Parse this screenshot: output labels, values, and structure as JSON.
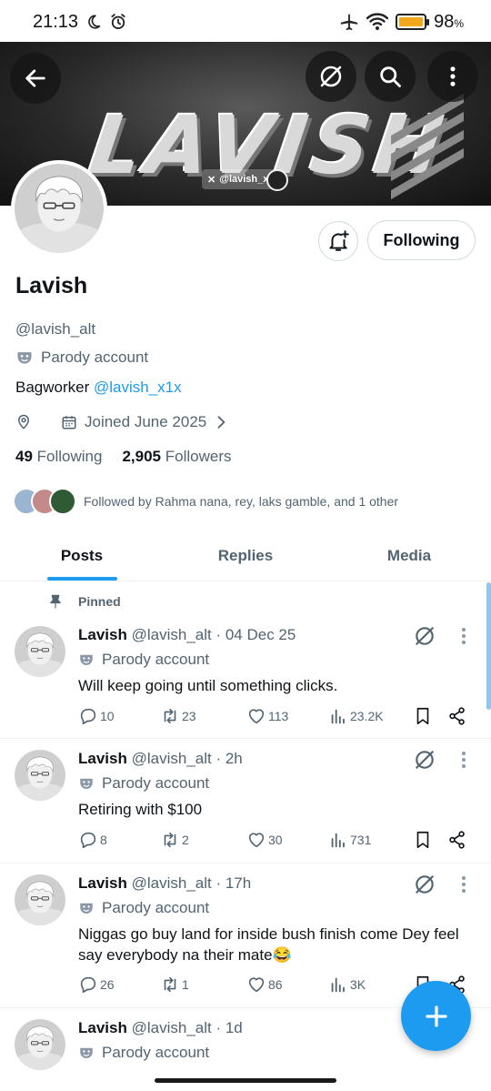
{
  "status_bar": {
    "time": "21:13",
    "battery": "98",
    "battery_unit": "%",
    "battery_level": 0.98
  },
  "banner": {
    "word": "LAVISH",
    "handle": "@lavish_x1x"
  },
  "profile": {
    "name": "Lavish",
    "handle": "@lavish_alt",
    "parody_label": "Parody account",
    "bio_text": "Bagworker ",
    "bio_mention": "@lavish_x1x",
    "joined": "Joined June 2025",
    "following_count": "49",
    "following_label": "Following",
    "followers_count": "2,905",
    "followers_label": "Followers",
    "followed_by": "Followed by Rahma nana, rey, laks gamble, and 1 other",
    "following_button": "Following"
  },
  "tabs": [
    {
      "label": "Posts"
    },
    {
      "label": "Replies"
    },
    {
      "label": "Media"
    }
  ],
  "pinned_label": "Pinned",
  "posts": [
    {
      "name": "Lavish",
      "meta": "@lavish_alt · 04 Dec 25",
      "parody": "Parody account",
      "text": "Will keep going until something clicks.",
      "replies": "10",
      "reposts": "23",
      "likes": "113",
      "views": "23.2K"
    },
    {
      "name": "Lavish",
      "meta": "@lavish_alt · 2h",
      "parody": "Parody account",
      "text": "Retiring with $100",
      "replies": "8",
      "reposts": "2",
      "likes": "30",
      "views": "731"
    },
    {
      "name": "Lavish",
      "meta": "@lavish_alt · 17h",
      "parody": "Parody account",
      "text": "Niggas go buy land for inside bush finish come Dey feel say everybody na their mate😂",
      "replies": "26",
      "reposts": "1",
      "likes": "86",
      "views": "3K"
    },
    {
      "name": "Lavish",
      "meta": "@lavish_alt · 1d",
      "parody": "Parody account"
    }
  ],
  "colors": {
    "accent": "#1d9bf0",
    "text": "#0f1419",
    "muted": "#536471",
    "battery": "#f2a91e"
  },
  "icons": [
    "back-arrow-icon",
    "grok-icon",
    "search-icon",
    "more-vertical-icon",
    "bell-plus-icon",
    "location-icon",
    "calendar-icon",
    "chevron-right-icon",
    "pin-icon",
    "reply-icon",
    "repost-icon",
    "like-icon",
    "views-icon",
    "bookmark-icon",
    "share-icon",
    "compose-plus-icon"
  ]
}
